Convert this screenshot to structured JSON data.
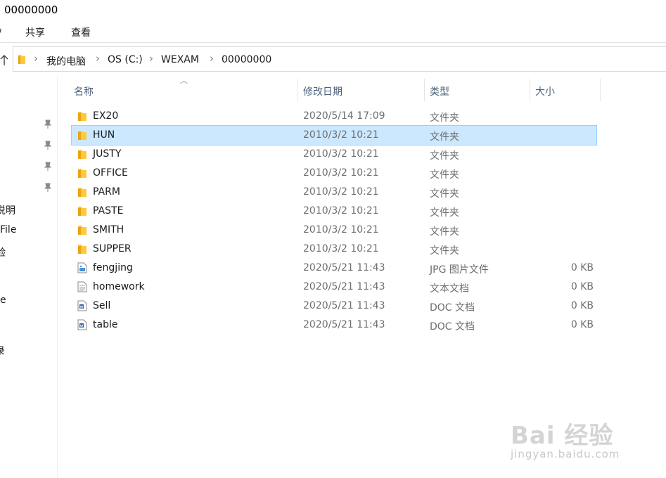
{
  "window": {
    "title": "00000000"
  },
  "ribbon": {
    "cut_tab": "ﾉ",
    "tabs": [
      "共享",
      "查看"
    ]
  },
  "breadcrumb": [
    "我的电脑",
    "OS (C:)",
    "WEXAM",
    "00000000"
  ],
  "nav_pane": {
    "partial_labels": [
      "说明",
      "File",
      "验",
      "e",
      "录"
    ]
  },
  "columns": {
    "name": "名称",
    "date": "修改日期",
    "type": "类型",
    "size": "大小"
  },
  "files": [
    {
      "name": "EX20",
      "date": "2020/5/14 17:09",
      "type": "文件夹",
      "size": "",
      "icon": "folder-icon",
      "selected": false
    },
    {
      "name": "HUN",
      "date": "2010/3/2 10:21",
      "type": "文件夹",
      "size": "",
      "icon": "folder-icon",
      "selected": true
    },
    {
      "name": "JUSTY",
      "date": "2010/3/2 10:21",
      "type": "文件夹",
      "size": "",
      "icon": "folder-icon",
      "selected": false
    },
    {
      "name": "OFFICE",
      "date": "2010/3/2 10:21",
      "type": "文件夹",
      "size": "",
      "icon": "folder-icon",
      "selected": false
    },
    {
      "name": "PARM",
      "date": "2010/3/2 10:21",
      "type": "文件夹",
      "size": "",
      "icon": "folder-icon",
      "selected": false
    },
    {
      "name": "PASTE",
      "date": "2010/3/2 10:21",
      "type": "文件夹",
      "size": "",
      "icon": "folder-icon",
      "selected": false
    },
    {
      "name": "SMITH",
      "date": "2010/3/2 10:21",
      "type": "文件夹",
      "size": "",
      "icon": "folder-icon",
      "selected": false
    },
    {
      "name": "SUPPER",
      "date": "2010/3/2 10:21",
      "type": "文件夹",
      "size": "",
      "icon": "folder-icon",
      "selected": false
    },
    {
      "name": "fengjing",
      "date": "2020/5/21 11:43",
      "type": "JPG 图片文件",
      "size": "0 KB",
      "icon": "image-file-icon",
      "selected": false
    },
    {
      "name": "homework",
      "date": "2020/5/21 11:43",
      "type": "文本文档",
      "size": "0 KB",
      "icon": "text-file-icon",
      "selected": false
    },
    {
      "name": "Sell",
      "date": "2020/5/21 11:43",
      "type": "DOC 文档",
      "size": "0 KB",
      "icon": "word-doc-icon",
      "selected": false
    },
    {
      "name": "table",
      "date": "2020/5/21 11:43",
      "type": "DOC 文档",
      "size": "0 KB",
      "icon": "word-doc-icon",
      "selected": false
    }
  ],
  "watermark": {
    "brand": "Bai  经验",
    "url": "jingyan.baidu.com"
  },
  "colors": {
    "selection": "#cce8ff",
    "folder": "#ffc83d",
    "header_text": "#4c607a"
  }
}
